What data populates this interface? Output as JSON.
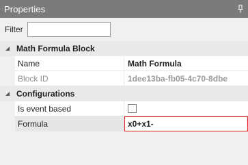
{
  "window": {
    "title": "Properties",
    "pin_icon": "pin-icon"
  },
  "filter": {
    "label": "Filter",
    "value": "",
    "placeholder": ""
  },
  "categories": [
    {
      "label": "Math Formula Block",
      "properties": [
        {
          "name": "Name",
          "value": "Math Formula"
        },
        {
          "name": "Block ID",
          "value": "1dee13ba-fb05-4c70-8dbe"
        }
      ]
    },
    {
      "label": "Configurations",
      "properties": [
        {
          "name": "Is event based",
          "value": false
        },
        {
          "name": "Formula",
          "value": "x0+x1-"
        }
      ]
    }
  ],
  "colors": {
    "titlebar": "#7b7b7b",
    "editor_border": "#e02020"
  }
}
